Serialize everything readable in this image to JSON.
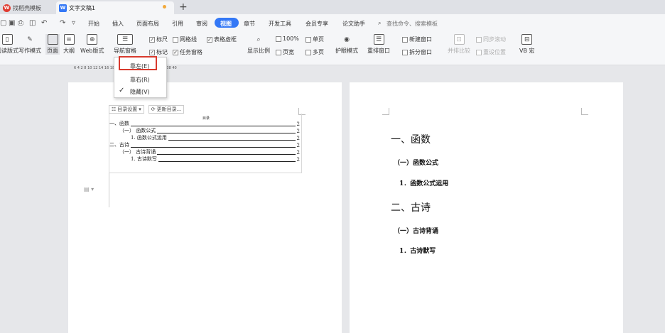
{
  "tabs": [
    {
      "label": "找稻壳模板",
      "icon": "wps-icon"
    },
    {
      "label": "文字文稿1",
      "icon": "writer-icon"
    }
  ],
  "menu": [
    "开始",
    "插入",
    "页面布局",
    "引用",
    "审阅",
    "视图",
    "章节",
    "开发工具",
    "会员专享",
    "论文助手"
  ],
  "active_menu": "视图",
  "search_placeholder": "查找命令、搜索模板",
  "ribbon": {
    "read_mode": "阅读版式",
    "write_mode": "写作模式",
    "page": "页面",
    "outline": "大纲",
    "web": "Web版式",
    "nav_pane": "导航窗格",
    "ruler": "标尺",
    "gridlines": "网格线",
    "table_lines": "表格虚框",
    "markup": "标记",
    "task_pane": "任务窗格",
    "zoom": "显示比例",
    "zoom_value": "100%",
    "single_page": "单页",
    "page_width": "页宽",
    "multi_page": "多页",
    "eye_mode": "护眼模式",
    "rearrange": "重排窗口",
    "new_window": "新建窗口",
    "split_window": "拆分窗口",
    "side_compare": "并排比较",
    "sync_scroll": "同步滚动",
    "reset_position": "重设位置",
    "vb": "VB 宏"
  },
  "ruler_ticks": "6  4  2        8  10  12  14  16  18  20  22  24  26  28  30  32  34  36  38  40",
  "dropdown": {
    "items": [
      {
        "label": "靠左(E)",
        "checked": false,
        "highlighted": true
      },
      {
        "label": "靠右(R)",
        "checked": false,
        "highlighted": false
      },
      {
        "label": "隐藏(V)",
        "checked": true,
        "highlighted": false
      }
    ]
  },
  "toc": {
    "settings_button": "目录设置",
    "update_button": "更新目录...",
    "title": "目录",
    "entries": [
      {
        "text": "一、函数",
        "page": "2"
      },
      {
        "text": "（一） 函数公式",
        "page": "2"
      },
      {
        "text": "1. 函数公式运用",
        "page": "2"
      },
      {
        "text": "二、古诗",
        "page": "2"
      },
      {
        "text": "（一） 古诗背诵",
        "page": "2"
      },
      {
        "text": "1. 古诗默写",
        "page": "2"
      }
    ]
  },
  "document": {
    "h1_1": "一、函数",
    "h2_1": "（一）函数公式",
    "h3_1": "1．函数公式运用",
    "h1_2": "二、古诗",
    "h2_2": "（一）古诗背诵",
    "h3_2": "1．古诗默写"
  },
  "colors": {
    "accent": "#3478f6",
    "highlight_border": "#d83a2e",
    "tab_dot": "#f2a93b"
  }
}
